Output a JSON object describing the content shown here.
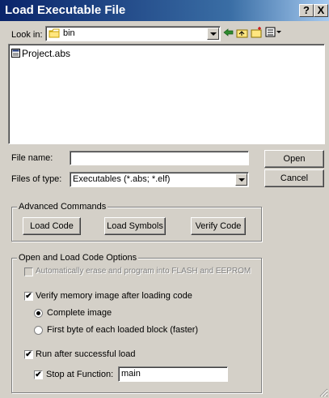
{
  "window": {
    "title": "Load Executable File",
    "help_glyph": "?",
    "close_glyph": "X"
  },
  "lookin": {
    "label": "Look in:",
    "value": "bin",
    "icons": [
      "folder-icon",
      "back-arrow-icon",
      "up-folder-icon",
      "new-folder-icon",
      "view-menu-icon"
    ]
  },
  "files": [
    {
      "name": "Project.abs",
      "icon": "file-icon"
    }
  ],
  "filename": {
    "label": "File name:",
    "value": ""
  },
  "filetype": {
    "label": "Files of type:",
    "value": "Executables (*.abs; *.elf)"
  },
  "buttons": {
    "open": "Open",
    "cancel": "Cancel"
  },
  "advanced": {
    "title": "Advanced Commands",
    "load_code": "Load Code",
    "load_symbols": "Load Symbols",
    "verify_code": "Verify Code"
  },
  "options": {
    "title": "Open and Load Code Options",
    "auto_erase": {
      "label": "Automatically erase and program into FLASH and EEPROM",
      "checked": false,
      "enabled": false
    },
    "verify": {
      "label": "Verify memory image after loading code",
      "checked": true,
      "check_glyph": "✔"
    },
    "complete_image": {
      "label": "Complete image",
      "selected": true
    },
    "first_byte": {
      "label": "First byte of each loaded block (faster)",
      "selected": false
    },
    "run_after": {
      "label": "Run after successful load",
      "checked": true,
      "check_glyph": "✔"
    },
    "stop_at": {
      "label": "Stop at Function:",
      "checked": true,
      "check_glyph": "✔",
      "value": "main"
    }
  }
}
